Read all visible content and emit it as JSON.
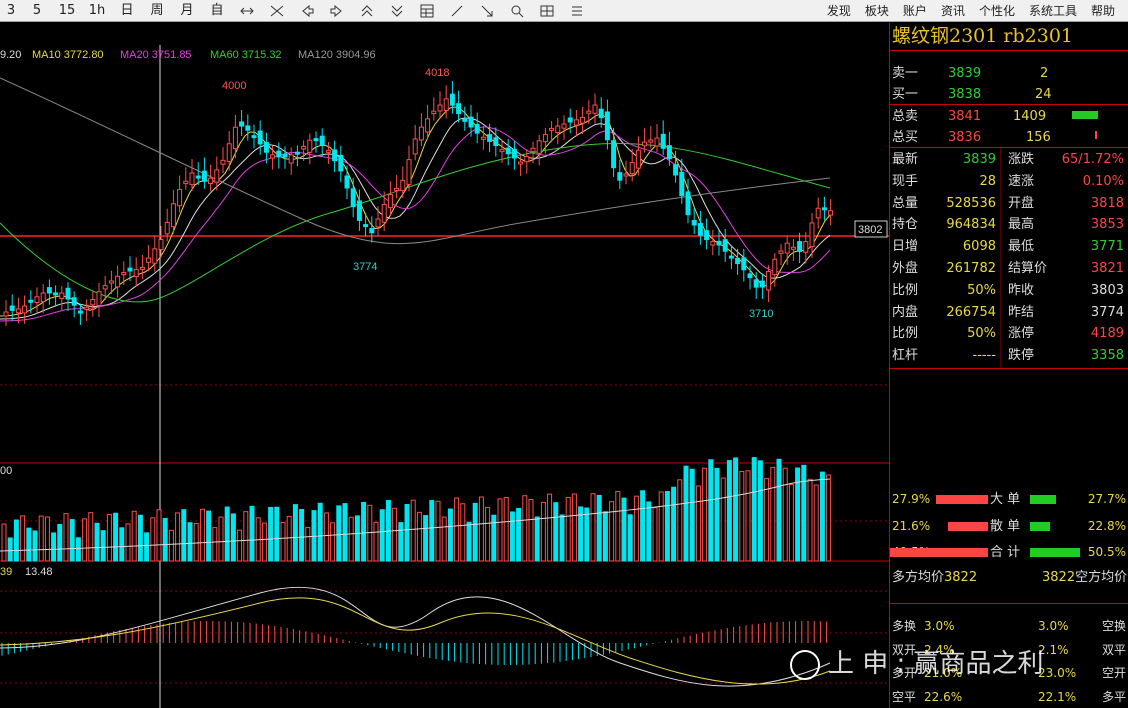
{
  "toolbar": {
    "periods": [
      "3",
      "5",
      "15",
      "1h",
      "日",
      "周",
      "月",
      "自"
    ],
    "menu": [
      "发现",
      "板块",
      "账户",
      "资讯",
      "个性化",
      "系统工具",
      "帮助"
    ]
  },
  "ma_legend": {
    "cut": "9.20",
    "ma10": "MA10 3772.80",
    "ma20": "MA20 3751.85",
    "ma60": "MA60 3715.32",
    "ma120": "MA120 3904.96"
  },
  "price_labels": {
    "high1": "4000",
    "high2": "4018",
    "low1": "3774",
    "low2": "3710",
    "ref": "3802"
  },
  "volume_labels": {
    "top": "00"
  },
  "macd_labels": {
    "a": "39",
    "b": "13.48"
  },
  "panel": {
    "title": "螺纹钢2301  rb2301",
    "sell1": {
      "label": "卖一",
      "price": "3839",
      "vol": "2"
    },
    "buy1": {
      "label": "买一",
      "price": "3838",
      "vol": "24"
    },
    "tsell": {
      "label": "总卖",
      "price": "3841",
      "vol": "1409"
    },
    "tbuy": {
      "label": "总买",
      "price": "3836",
      "vol": "156"
    },
    "stats": [
      {
        "l1": "最新",
        "v1": "3839",
        "c1": "g",
        "l2": "涨跌",
        "v2": "65/1.72%",
        "c2": "r"
      },
      {
        "l1": "现手",
        "v1": "28",
        "c1": "y",
        "l2": "速涨",
        "v2": "0.10%",
        "c2": "r"
      },
      {
        "l1": "总量",
        "v1": "528536",
        "c1": "y",
        "l2": "开盘",
        "v2": "3818",
        "c2": "r"
      },
      {
        "l1": "持仓",
        "v1": "964834",
        "c1": "y",
        "l2": "最高",
        "v2": "3853",
        "c2": "r"
      },
      {
        "l1": "日增",
        "v1": "6098",
        "c1": "y",
        "l2": "最低",
        "v2": "3771",
        "c2": "g"
      },
      {
        "l1": "外盘",
        "v1": "261782",
        "c1": "y",
        "l2": "结算价",
        "v2": "3821",
        "c2": "r"
      },
      {
        "l1": "比例",
        "v1": "50%",
        "c1": "y",
        "l2": "昨收",
        "v2": "3803",
        "c2": "w"
      },
      {
        "l1": "内盘",
        "v1": "266754",
        "c1": "y",
        "l2": "昨结",
        "v2": "3774",
        "c2": "w"
      },
      {
        "l1": "比例",
        "v1": "50%",
        "c1": "y",
        "l2": "涨停",
        "v2": "4189",
        "c2": "r"
      },
      {
        "l1": "杠杆",
        "v1": "-----",
        "c1": "y",
        "l2": "跌停",
        "v2": "3358",
        "c2": "g"
      }
    ],
    "flow": [
      {
        "left": "27.9%",
        "label": "大  单",
        "right": "27.7%"
      },
      {
        "left": "21.6%",
        "label": "散  单",
        "right": "22.8%"
      },
      {
        "left": "49.5%",
        "label": "合  计",
        "right": "50.5%"
      }
    ],
    "avg_left": "多方均价",
    "avg_left_val": "3822",
    "avg_right_val": "3822",
    "avg_right": "空方均价",
    "open_close": [
      {
        "l": "多换",
        "lv": "3.0%",
        "rv": "3.0%",
        "r": "空换"
      },
      {
        "l": "双开",
        "lv": "2.4%",
        "rv": "2.1%",
        "r": "双平"
      },
      {
        "l": "多开",
        "lv": "21.0%",
        "rv": "23.0%",
        "r": "空开"
      },
      {
        "l": "空平",
        "lv": "22.6%",
        "rv": "22.1%",
        "r": "多平"
      }
    ],
    "watermark": "上  申 : 赢商品之利"
  }
}
